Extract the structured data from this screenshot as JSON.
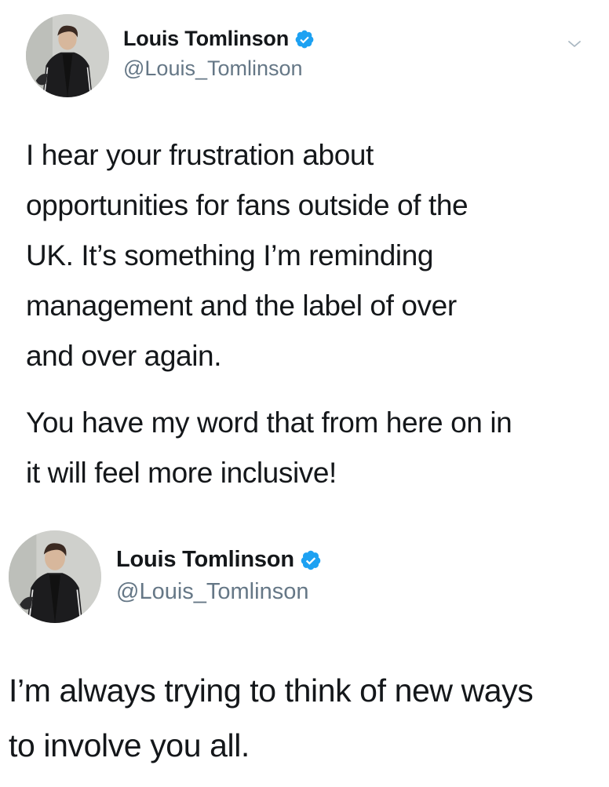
{
  "tweets": [
    {
      "author": {
        "display_name": "Louis Tomlinson",
        "handle": "@Louis_Tomlinson",
        "verified": true,
        "avatar_icon": "profile-photo"
      },
      "menu_icon": "chevron-down-icon",
      "paragraphs": [
        {
          "lines": [
            "I hear your frustration about",
            "opportunities for fans outside of the",
            "UK. It’s something I’m reminding",
            "management and the label of over",
            "and over again."
          ]
        },
        {
          "lines": [
            "You have my word that from here on in",
            "it will feel more inclusive!"
          ]
        }
      ]
    },
    {
      "author": {
        "display_name": "Louis Tomlinson",
        "handle": "@Louis_Tomlinson",
        "verified": true,
        "avatar_icon": "profile-photo"
      },
      "paragraphs": [
        {
          "lines": [
            "I’m always trying to think of new ways",
            "to involve you all."
          ]
        }
      ]
    }
  ],
  "colors": {
    "text": "#14171a",
    "secondary": "#657786",
    "verified_blue": "#1da1f2",
    "background": "#ffffff"
  }
}
